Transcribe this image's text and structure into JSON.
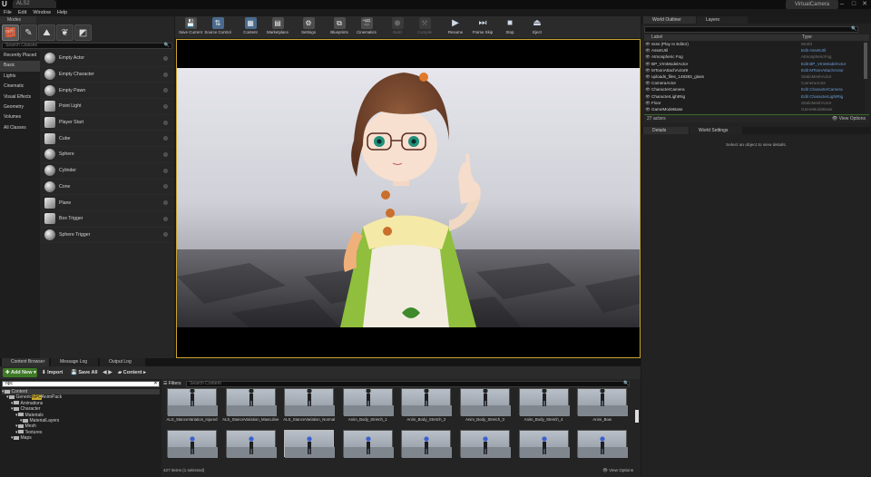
{
  "window": {
    "doc_tab": "ALS2",
    "project_name": "VirtualCamera",
    "controls": [
      "–",
      "□",
      "✕"
    ]
  },
  "menu": [
    "File",
    "Edit",
    "Window",
    "Help"
  ],
  "modes": {
    "tab_label": "Modes",
    "search_placeholder": "Search Classes",
    "categories": [
      "Recently Placed",
      "Basic",
      "Lights",
      "Cinematic",
      "Visual Effects",
      "Geometry",
      "Volumes",
      "All Classes"
    ],
    "selected_category": "Basic",
    "items": [
      "Empty Actor",
      "Empty Character",
      "Empty Pawn",
      "Point Light",
      "Player Start",
      "Cube",
      "Sphere",
      "Cylinder",
      "Cone",
      "Plane",
      "Box Trigger",
      "Sphere Trigger"
    ]
  },
  "toolbar": {
    "buttons": [
      "Save Current",
      "Source Control",
      "Content",
      "Marketplace",
      "Settings",
      "Blueprints",
      "Cinematics",
      "Build",
      "Compile",
      "Resume",
      "Frame Skip",
      "Stop",
      "Eject"
    ]
  },
  "outliner": {
    "tabs": [
      "World Outliner",
      "Layers"
    ],
    "columns": {
      "label": "Label",
      "type": "Type"
    },
    "rows": [
      {
        "label": "ssss (Play In Editor)",
        "type": "World",
        "link": false
      },
      {
        "label": "AssetUtil",
        "type": "Edit AssetUtil",
        "link": true
      },
      {
        "label": "Atmospheric Fog",
        "type": "AtmosphericFog",
        "link": false
      },
      {
        "label": "BP_VrmModelActor",
        "type": "Edit BP_VrmModelActor",
        "link": true
      },
      {
        "label": "MToonAttachActor9",
        "type": "Edit MToonAttachActor",
        "link": true
      },
      {
        "label": "uploads_files_148383_glass",
        "type": "StaticMeshActor",
        "link": false
      },
      {
        "label": "CameraActor",
        "type": "CameraActor",
        "link": false
      },
      {
        "label": "CharacterCamera",
        "type": "Edit CharacterCamera",
        "link": true
      },
      {
        "label": "CharacterLightRig",
        "type": "Edit CharacterLightRig",
        "link": true
      },
      {
        "label": "Floor",
        "type": "StaticMeshActor",
        "link": false
      },
      {
        "label": "GameModeBase",
        "type": "GameModeBase",
        "link": false
      }
    ],
    "actor_count": "27 actors",
    "view_options": "View Options"
  },
  "details": {
    "tabs": [
      "Details",
      "World Settings"
    ],
    "empty_message": "Select an object to view details."
  },
  "content_browser": {
    "tabs": [
      "Content Browser",
      "Message Log",
      "Output Log"
    ],
    "add_new": "Add New",
    "import": "Import",
    "save_all": "Save All",
    "breadcrumb": "Content",
    "tree_search": "npc",
    "tree": [
      {
        "label": "Content",
        "indent": 0
      },
      {
        "label": "GenericNPCAnimPack",
        "indent": 1,
        "highlight": "NPC"
      },
      {
        "label": "Animations",
        "indent": 2
      },
      {
        "label": "Character",
        "indent": 2
      },
      {
        "label": "Materials",
        "indent": 3
      },
      {
        "label": "MaterialLayers",
        "indent": 4
      },
      {
        "label": "Mesh",
        "indent": 3
      },
      {
        "label": "Textures",
        "indent": 3
      },
      {
        "label": "Maps",
        "indent": 2
      }
    ],
    "filters": "Filters",
    "asset_search_placeholder": "Search Content",
    "assets_row1": [
      "ALS_StanceVariation_Injured",
      "ALS_StanceVariation_Masculine",
      "ALS_StanceVariation_Normal",
      "Anim_Body_Stretch_1",
      "Anim_Body_Stretch_2",
      "Anim_Body_Stretch_3",
      "Anim_Body_Stretch_4",
      "Anim_Bow"
    ],
    "item_count": "427 items (1 selected)",
    "view_options": "View Options"
  }
}
